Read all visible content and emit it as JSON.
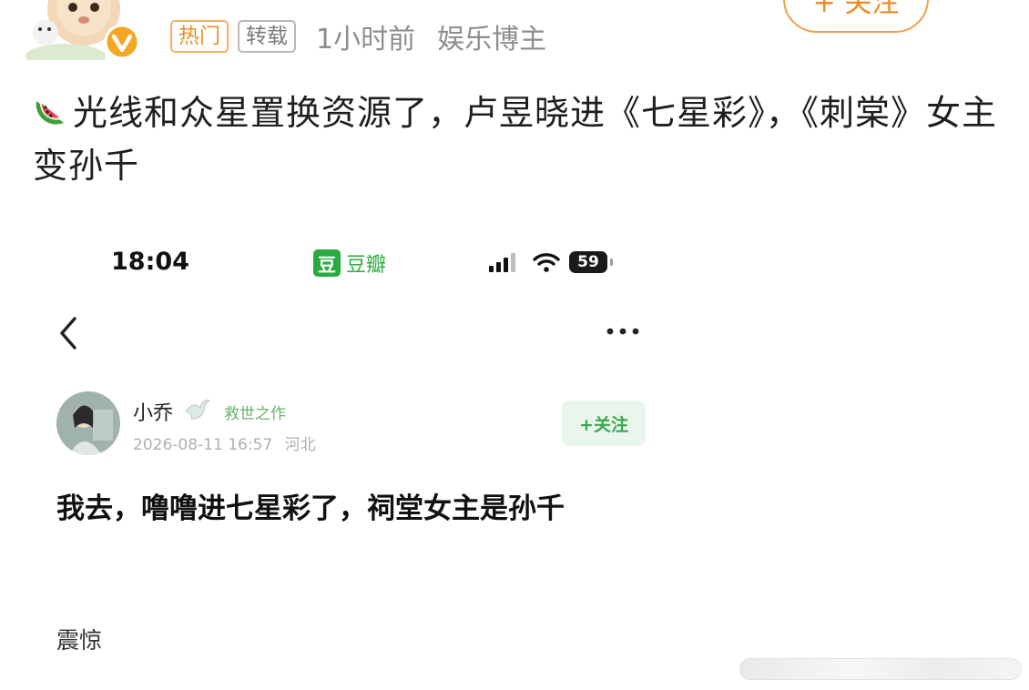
{
  "post": {
    "tags": {
      "hot": "热门",
      "repost": "转载"
    },
    "time": "1小时前",
    "author_type": "娱乐博主",
    "follow_label": "+ 关注",
    "headline": "光线和众星置换资源了，卢昱晓进《七星彩》，《刺棠》女主变孙千"
  },
  "embedded": {
    "status_bar": {
      "time": "18:04",
      "app_logo": "豆",
      "app_name": "豆瓣",
      "battery": "59"
    },
    "user": {
      "name": "小乔",
      "badge": "救世之作",
      "date": "2026-08-11 16:57",
      "location": "河北",
      "follow_label": "+关注"
    },
    "title": "我去，噜噜进七星彩了，祠堂女主是孙千",
    "body": "震惊"
  },
  "colors": {
    "accent_orange": "#f08a1e",
    "douban_green": "#2aab3f",
    "meta_gray": "#8e8e8e"
  },
  "icons": [
    "watermelon-icon",
    "back-arrow-icon",
    "more-icon",
    "signal-icon",
    "wifi-icon",
    "battery-icon",
    "bird-icon",
    "verified-icon"
  ]
}
